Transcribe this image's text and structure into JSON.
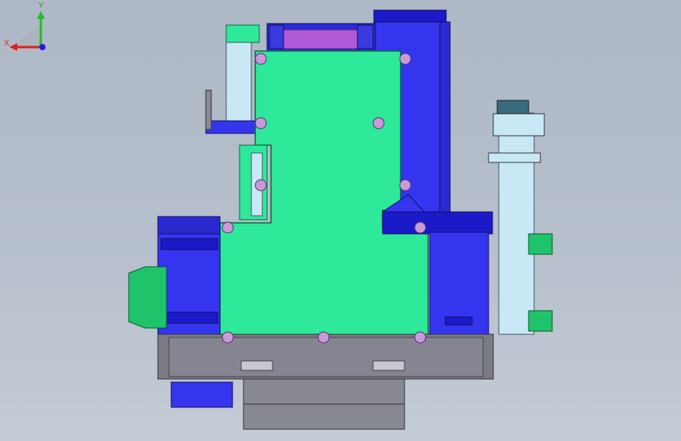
{
  "viewport": {
    "background_top": "#aeb8c6",
    "background_bottom": "#c4ccd6"
  },
  "model_colors": {
    "plate": "#2ee99a",
    "blue_block": "#3535f0",
    "dark_blue": "#1a1ac8",
    "gray_base": "#7b7b86",
    "light_blue": "#c8e8f6",
    "magenta": "#b05ad8",
    "green_accent": "#1fc46a",
    "bolt": "#c89ad8"
  },
  "triad": {
    "x_label": "X",
    "y_label": "Y",
    "x_color": "#e02020",
    "y_color": "#20c020",
    "z_color": "#2020e0"
  }
}
